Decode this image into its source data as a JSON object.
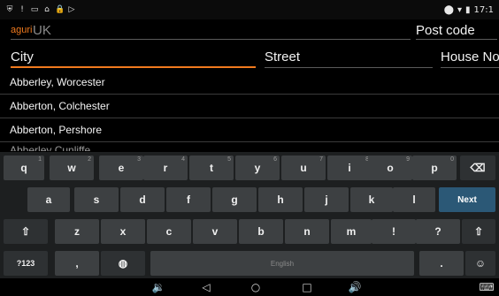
{
  "status_bar": {
    "left_icons": [
      "shield-icon",
      "alert-icon",
      "screen-icon",
      "hanger-icon",
      "lock-icon",
      "play-icon"
    ],
    "right_icons": [
      "location-icon",
      "wifi-icon",
      "battery-icon"
    ],
    "time": "17:1"
  },
  "search": {
    "logo": "aguri",
    "country_value": "UK",
    "postcode_label": "Post code"
  },
  "fields": {
    "city_label": "City",
    "street_label": "Street",
    "house_no_label": "House No"
  },
  "list": {
    "items": [
      "Abberley, Worcester",
      "Abberton, Colchester",
      "Abberton, Pershore"
    ],
    "partial_item": "Abberley Cunliffe..."
  },
  "keyboard": {
    "row1": [
      {
        "label": "q",
        "hint": "1"
      },
      {
        "label": "w",
        "hint": "2"
      },
      {
        "label": "e",
        "hint": "3"
      },
      {
        "label": "r",
        "hint": "4"
      },
      {
        "label": "t",
        "hint": "5"
      },
      {
        "label": "y",
        "hint": "6"
      },
      {
        "label": "u",
        "hint": "7"
      },
      {
        "label": "i",
        "hint": "8"
      },
      {
        "label": "o",
        "hint": "9"
      },
      {
        "label": "p",
        "hint": "0"
      }
    ],
    "backspace_icon": "⌫",
    "row2": [
      {
        "label": "a"
      },
      {
        "label": "s"
      },
      {
        "label": "d"
      },
      {
        "label": "f"
      },
      {
        "label": "g"
      },
      {
        "label": "h"
      },
      {
        "label": "j"
      },
      {
        "label": "k"
      },
      {
        "label": "l"
      }
    ],
    "next_label": "Next",
    "row3": [
      {
        "label": "z"
      },
      {
        "label": "x"
      },
      {
        "label": "c"
      },
      {
        "label": "v"
      },
      {
        "label": "b"
      },
      {
        "label": "n"
      },
      {
        "label": "m"
      },
      {
        "label": "!"
      },
      {
        "label": "?"
      }
    ],
    "shift_icon": "⇧",
    "symbols_label": "?123",
    "comma_label": ",",
    "space_label": "English",
    "period_label": ".",
    "emoji_icon": "☺"
  },
  "navbar": {
    "back_icon": "◁",
    "home_icon": "○",
    "recents_icon": "□",
    "volume_down_icon": "🔉",
    "volume_up_icon": "🔊",
    "keyboard_icon": "⌨"
  }
}
